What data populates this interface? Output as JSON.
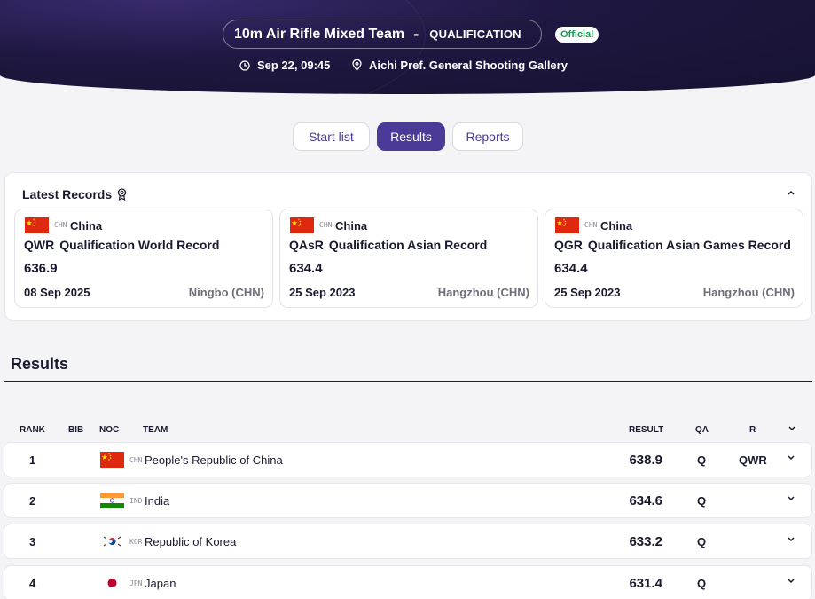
{
  "header": {
    "event": "10m Air Rifle Mixed Team",
    "separator": "-",
    "phase": "QUALIFICATION",
    "status": "Official",
    "datetime": "Sep 22, 09:45",
    "venue": "Aichi Pref. General Shooting Gallery",
    "clock_icon": "clock-icon",
    "location_icon": "location-pin-icon"
  },
  "tabs": [
    {
      "label": "Start list",
      "active": false
    },
    {
      "label": "Results",
      "active": true
    },
    {
      "label": "Reports",
      "active": false
    }
  ],
  "records": {
    "title": "Latest Records",
    "items": [
      {
        "noc": "CHN",
        "country": "China",
        "abbr": "QWR",
        "name": "Qualification World Record",
        "score": "636.9",
        "date": "08 Sep 2025",
        "location": "Ningbo (CHN)"
      },
      {
        "noc": "CHN",
        "country": "China",
        "abbr": "QAsR",
        "name": "Qualification Asian Record",
        "score": "634.4",
        "date": "25 Sep 2023",
        "location": "Hangzhou (CHN)"
      },
      {
        "noc": "CHN",
        "country": "China",
        "abbr": "QGR",
        "name": "Qualification Asian Games Record",
        "score": "634.4",
        "date": "25 Sep 2023",
        "location": "Hangzhou (CHN)"
      }
    ]
  },
  "results": {
    "title": "Results",
    "columns": {
      "rank": "RANK",
      "bib": "BIB",
      "noc": "NOC",
      "team": "TEAM",
      "result": "RESULT",
      "qa": "QA",
      "r": "R"
    },
    "rows": [
      {
        "rank": "1",
        "noc": "CHN",
        "team": "People's Republic of China",
        "result": "638.9",
        "qa": "Q",
        "r": "QWR"
      },
      {
        "rank": "2",
        "noc": "IND",
        "team": "India",
        "result": "634.6",
        "qa": "Q",
        "r": ""
      },
      {
        "rank": "3",
        "noc": "KOR",
        "team": "Republic of Korea",
        "result": "633.2",
        "qa": "Q",
        "r": ""
      },
      {
        "rank": "4",
        "noc": "JPN",
        "team": "Japan",
        "result": "631.4",
        "qa": "Q",
        "r": ""
      }
    ]
  },
  "colors": {
    "header_bg": "#1e1740",
    "accent": "#4b3b96",
    "official_green": "#1d9a55",
    "china_red": "#de2910",
    "china_star": "#ffde00",
    "india_saffron": "#ff9933",
    "india_green": "#138808",
    "japan_red": "#bc002d"
  }
}
